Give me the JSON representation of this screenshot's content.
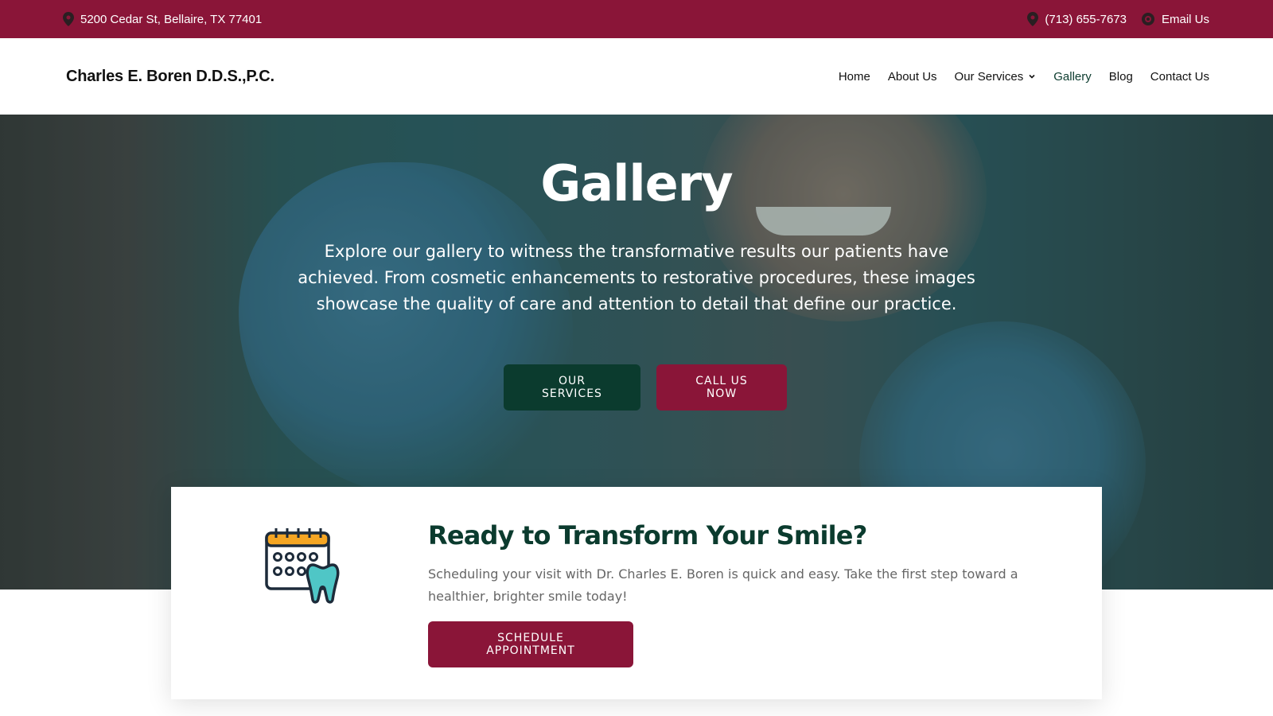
{
  "topbar": {
    "address": "5200 Cedar St, Bellaire, TX 77401",
    "phone": "(713) 655-7673",
    "email_label": "Email Us"
  },
  "header": {
    "logo": "Charles E. Boren D.D.S.,P.C.",
    "nav": {
      "home": "Home",
      "about": "About Us",
      "services": "Our Services",
      "gallery": "Gallery",
      "blog": "Blog",
      "contact": "Contact Us"
    }
  },
  "hero": {
    "title": "Gallery",
    "text": "Explore our gallery to witness the transformative results our patients have achieved. From cosmetic enhancements to restorative procedures, these images showcase the quality of care and attention to detail that define our practice.",
    "buttons": {
      "services": "OUR SERVICES",
      "call": "CALL US NOW"
    }
  },
  "cta": {
    "title": "Ready to Transform Your Smile?",
    "text": "Scheduling your visit with Dr. Charles E. Boren is quick and easy. Take the first step toward a healthier, brighter smile today!",
    "button": "SCHEDULE APPOINTMENT",
    "icon": "calendar-tooth-icon"
  },
  "colors": {
    "brand_red": "#8a1538",
    "brand_green": "#0b3b2e",
    "icon_orange": "#f5a623",
    "icon_teal": "#4fc6c6"
  }
}
